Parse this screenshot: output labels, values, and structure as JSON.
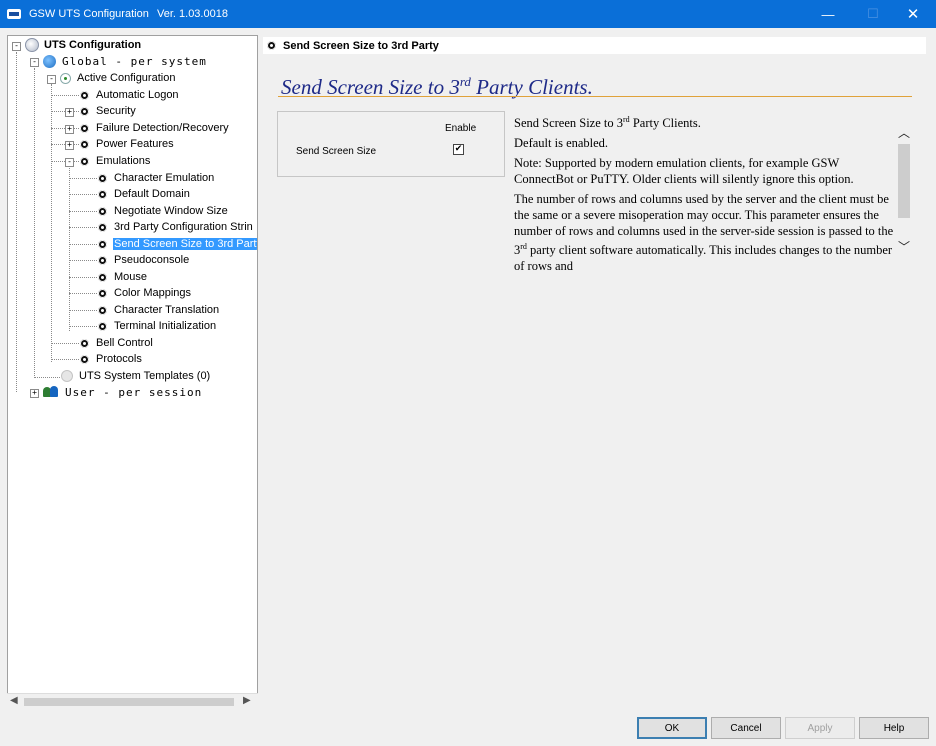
{
  "window": {
    "title": "GSW UTS Configuration",
    "version": "Ver. 1.03.0018",
    "minimize_glyph": "—",
    "maximize_glyph": "☐",
    "close_glyph": "✕"
  },
  "tree": {
    "root": "UTS Configuration",
    "global": "Global  - per system",
    "active_config": "Active Configuration",
    "items": [
      {
        "label": "Automatic Logon",
        "expander": ""
      },
      {
        "label": "Security",
        "expander": "+"
      },
      {
        "label": "Failure Detection/Recovery",
        "expander": "+"
      },
      {
        "label": "Power Features",
        "expander": "+"
      },
      {
        "label": "Emulations",
        "expander": "-"
      }
    ],
    "emulation_children": [
      "Character Emulation",
      "Default Domain",
      "Negotiate Window Size",
      "3rd Party Configuration Strin",
      "Send Screen Size to 3rd Party",
      "Pseudoconsole",
      "Mouse",
      "Color Mappings",
      "Character Translation",
      "Terminal Initialization"
    ],
    "selected": "Send Screen Size to 3rd Party",
    "after_items": [
      "Bell Control",
      "Protocols"
    ],
    "templates": "UTS System Templates (0)",
    "user": "User  - per session"
  },
  "panel": {
    "header": "Send Screen Size to 3rd Party",
    "heading_pre": "Send Screen Size to 3",
    "heading_sup": "rd",
    "heading_post": " Party Clients.",
    "enable_label": "Enable",
    "option_label": "Send Screen Size",
    "option_checked": true,
    "check_glyph": "✔"
  },
  "description": {
    "p1_pre": "Send Screen Size to 3",
    "p1_sup": "rd",
    "p1_post": " Party Clients.",
    "p2": "Default is enabled.",
    "p3": "Note: Supported by modern emulation clients, for example GSW ConnectBot or PuTTY. Older clients will silently ignore this option.",
    "p4_pre": "The number of rows and columns used by the server and the client must be the same or a severe misoperation may occur. This parameter ensures the number of rows and columns used in the server-side session is passed to the 3",
    "p4_sup": "rd",
    "p4_post": " party client software automatically. This includes changes to the number of rows and"
  },
  "buttons": {
    "ok": "OK",
    "cancel": "Cancel",
    "apply": "Apply",
    "help": "Help"
  }
}
